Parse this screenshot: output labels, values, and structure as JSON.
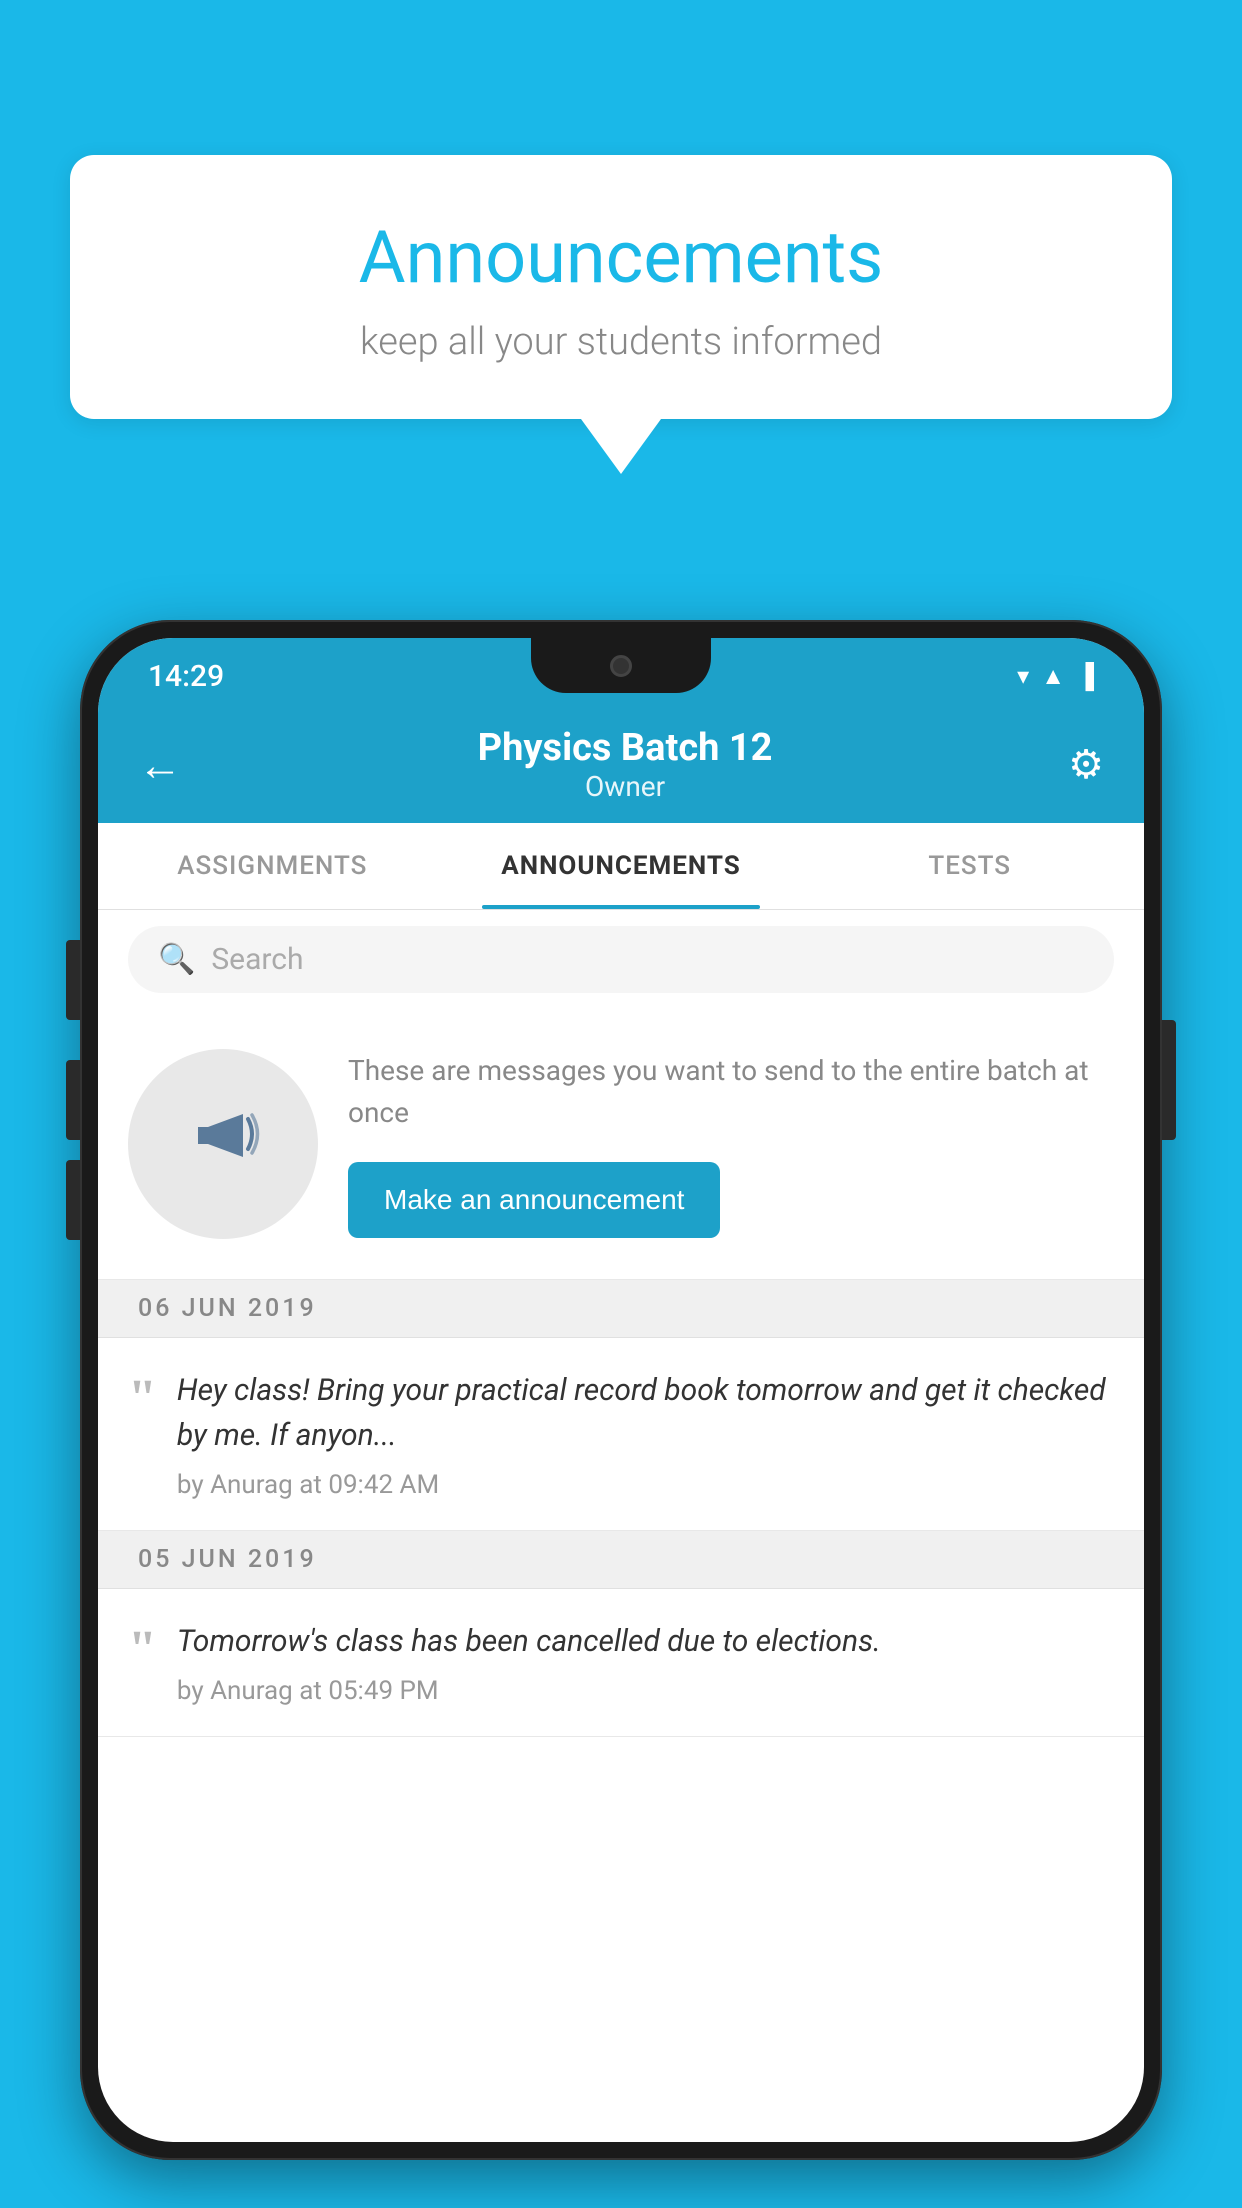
{
  "background": {
    "color": "#1ab8e8"
  },
  "speech_bubble": {
    "title": "Announcements",
    "subtitle": "keep all your students informed"
  },
  "phone": {
    "status_bar": {
      "time": "14:29"
    },
    "header": {
      "title": "Physics Batch 12",
      "subtitle": "Owner",
      "back_label": "←",
      "gear_label": "⚙"
    },
    "tabs": [
      {
        "label": "ASSIGNMENTS",
        "active": false
      },
      {
        "label": "ANNOUNCEMENTS",
        "active": true
      },
      {
        "label": "TESTS",
        "active": false
      }
    ],
    "search": {
      "placeholder": "Search"
    },
    "empty_state": {
      "description": "These are messages you want to send to the entire batch at once",
      "cta_label": "Make an announcement"
    },
    "announcements": [
      {
        "date": "06  JUN  2019",
        "message": "Hey class! Bring your practical record book tomorrow and get it checked by me. If anyon...",
        "meta": "by Anurag at 09:42 AM"
      },
      {
        "date": "05  JUN  2019",
        "message": "Tomorrow's class has been cancelled due to elections.",
        "meta": "by Anurag at 05:49 PM"
      }
    ]
  }
}
